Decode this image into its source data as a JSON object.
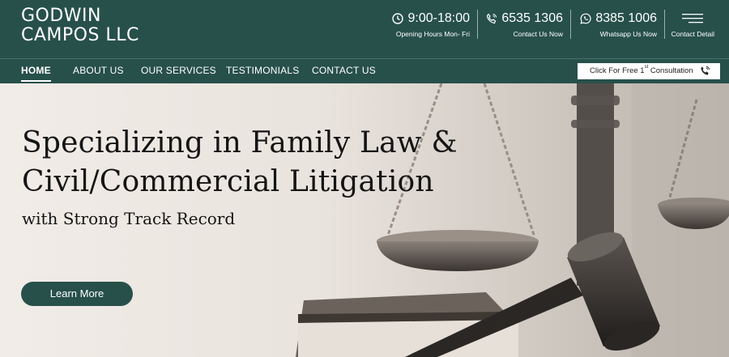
{
  "brand": {
    "line1": "GODWIN",
    "line2": "CAMPOS LLC"
  },
  "contact_bar": {
    "hours": {
      "value": "9:00-18:00",
      "caption": "Opening Hours Mon- Fri",
      "icon": "clock-icon"
    },
    "phone": {
      "value": "6535 1306",
      "caption": "Contact Us Now",
      "icon": "phone-icon"
    },
    "whatsapp": {
      "value": "8385 1006",
      "caption": "Whatsapp Us Now",
      "icon": "whatsapp-icon"
    },
    "detail": {
      "caption": "Contact Detail",
      "icon": "hamburger-menu-icon"
    }
  },
  "nav": {
    "items": [
      {
        "label": "HOME",
        "active": true
      },
      {
        "label": "ABOUT US"
      },
      {
        "label": "OUR SERVICES"
      },
      {
        "label": "TESTIMONIALS"
      },
      {
        "label": "CONTACT US"
      }
    ],
    "cta": {
      "prefix": "Click For Free 1",
      "superscript": "st",
      "suffix": " Consultation",
      "icon": "phone-icon"
    }
  },
  "hero": {
    "headline_line1": "Specializing in Family Law &",
    "headline_line2": "Civil/Commercial Litigation",
    "subheading": "with Strong Track Record",
    "button_label": "Learn More"
  },
  "colors": {
    "primary": "#27504b",
    "text": "#141414",
    "white": "#ffffff"
  }
}
